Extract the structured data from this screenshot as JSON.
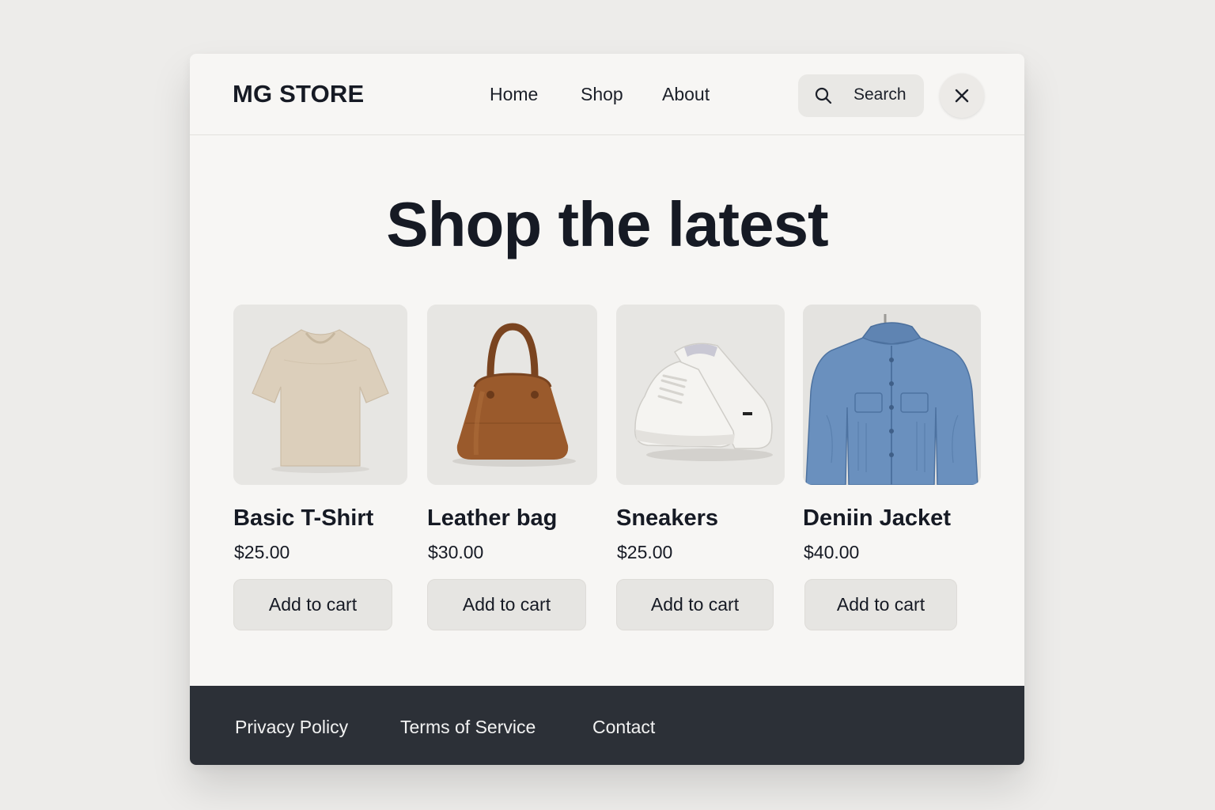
{
  "header": {
    "logo": "MG STORE",
    "nav": [
      "Home",
      "Shop",
      "About"
    ],
    "search_label": "Search",
    "icons": {
      "search": "search-icon",
      "close": "close-icon"
    }
  },
  "hero": {
    "title": "Shop the latest"
  },
  "products": [
    {
      "name": "Basic T-Shirt",
      "price": "$25.00",
      "button": "Add to cart",
      "image": "beige-t-shirt"
    },
    {
      "name": "Leather bag",
      "price": "$30.00",
      "button": "Add to cart",
      "image": "brown-leather-bag"
    },
    {
      "name": "Sneakers",
      "price": "$25.00",
      "button": "Add to cart",
      "image": "white-sneakers"
    },
    {
      "name": "Deniin Jacket",
      "price": "$40.00",
      "button": "Add to cart",
      "image": "denim-jacket"
    }
  ],
  "footer": {
    "links": [
      "Privacy Policy",
      "Terms of Service",
      "Contact"
    ]
  },
  "colors": {
    "page_background": "#edecea",
    "card_background": "#f7f6f4",
    "text": "#161a24",
    "button_background": "#e6e5e2",
    "footer_background": "#2c3037",
    "footer_text": "#f2f2f2"
  }
}
